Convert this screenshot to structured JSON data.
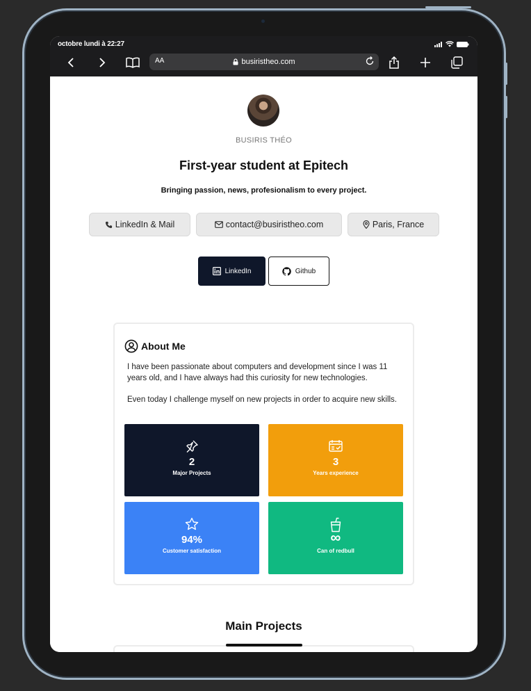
{
  "status_bar": {
    "time": "octobre lundi à 22:27"
  },
  "browser": {
    "text_size_label": "AA",
    "url": "busiristheo.com"
  },
  "profile": {
    "name": "BUSIRIS THÉO",
    "headline": "First-year student at Epitech",
    "tagline": "Bringing passion, news, profesionalism to every project."
  },
  "contact_pills": [
    {
      "label": "LinkedIn & Mail",
      "icon": "phone-icon"
    },
    {
      "label": "contact@busiristheo.com",
      "icon": "mail-icon"
    },
    {
      "label": "Paris, France",
      "icon": "map-pin-icon"
    }
  ],
  "social_buttons": [
    {
      "label": "LinkedIn",
      "icon": "linkedin-icon"
    },
    {
      "label": "Github",
      "icon": "github-icon"
    }
  ],
  "about": {
    "title": "About Me",
    "paragraph1": "I have been passionate about computers and development since I was 11 years old, and I have always had this curiosity for new technologies.",
    "paragraph2": "Even today I challenge myself on new projects in order to acquire new skills."
  },
  "stats": [
    {
      "value": "2",
      "label": "Major Projects",
      "icon": "pin-icon",
      "color": "#0f172a"
    },
    {
      "value": "3",
      "label": "Years experience",
      "icon": "calendar-check-icon",
      "color": "#f29e0c"
    },
    {
      "value": "94%",
      "label": "Customer satisfaction",
      "icon": "star-icon",
      "color": "#3b82f6"
    },
    {
      "value": "∞",
      "label": "Can of redbull",
      "icon": "cup-icon",
      "color": "#10b981"
    }
  ],
  "main_projects": {
    "title": "Main Projects"
  }
}
